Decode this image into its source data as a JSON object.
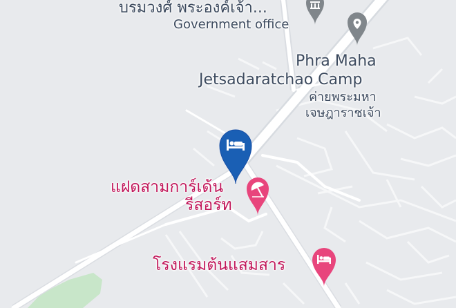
{
  "labels": {
    "government_thai": "บรมวงศ์ พระองค์เจ้า...",
    "government_type": "Government office",
    "camp_en_line1": "Phra Maha",
    "camp_en_line2": "Jetsadaratchao Camp",
    "camp_th_line1": "ค่ายพระมหา",
    "camp_th_line2": "เจษฎาราชเจ้า",
    "resort_line1": "แฝดสามการ์เด้น",
    "resort_line2": "รีสอร์ท",
    "hotel2": "โรงแรมต้นแสมสาร"
  },
  "icons": {
    "government": "government-building-icon",
    "camp": "place-pin-icon",
    "selected_hotel": "bed-icon",
    "resort": "beach-umbrella-icon",
    "hotel2": "bed-icon"
  },
  "colors": {
    "land": "#e8eaed",
    "road": "#ffffff",
    "park": "#c8e6c9",
    "selected_pin": "#1a5fb4",
    "pink_pin": "#e8457c",
    "pink_text": "#c2185b",
    "gray_pin": "#80868b",
    "label_text": "#3c4a5e"
  }
}
